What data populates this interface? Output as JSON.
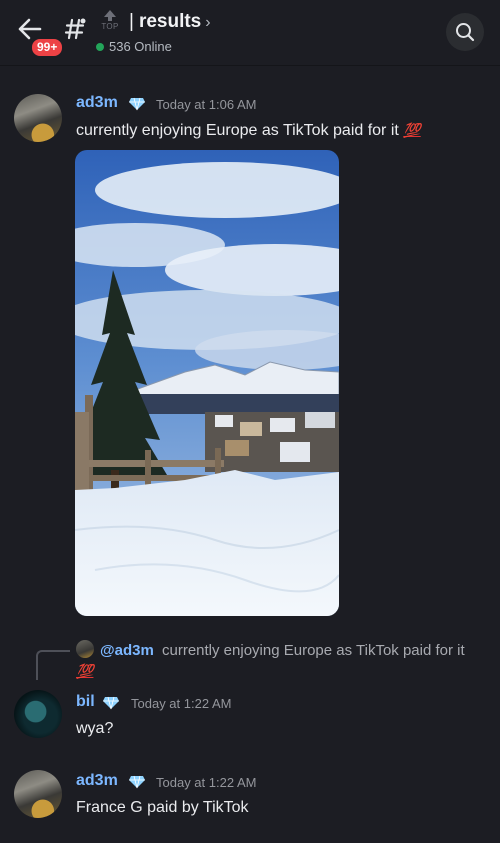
{
  "header": {
    "back_badge": "99+",
    "top_label": "TOP",
    "title": "results",
    "online_text": "536 Online"
  },
  "messages": [
    {
      "username": "ad3m",
      "timestamp": "Today at 1:06 AM",
      "text": "currently enjoying Europe as TikTok paid for it",
      "emoji": "💯"
    },
    {
      "reply_to_user": "@ad3m",
      "reply_to_text": "currently enjoying Europe as TikTok paid for it",
      "reply_emoji": "💯",
      "username": "bil",
      "timestamp": "Today at 1:22 AM",
      "text": "wya?"
    },
    {
      "username": "ad3m",
      "timestamp": "Today at 1:22 AM",
      "text": "France G paid by TikTok"
    }
  ],
  "colors": {
    "background": "#1c1d23",
    "username": "#7cb7ff",
    "badge": "#ed4245",
    "online": "#23a55a"
  },
  "icons": [
    "back-arrow-icon",
    "hash-icon",
    "top-arrow-icon",
    "search-icon",
    "diamond-icon"
  ]
}
